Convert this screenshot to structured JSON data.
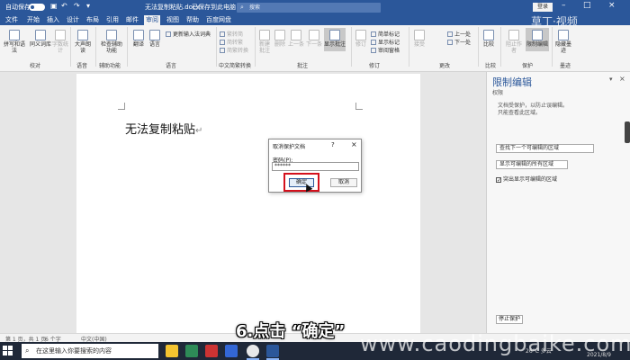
{
  "titlebar": {
    "autosave_label": "自动保存",
    "filename": "无法复制粘贴.docx",
    "saved_state": "已保存到此电脑",
    "search_placeholder": "搜索",
    "login": "登录"
  },
  "tabs": [
    "文件",
    "开始",
    "插入",
    "设计",
    "布局",
    "引用",
    "邮件",
    "审阅",
    "视图",
    "帮助",
    "百度网盘"
  ],
  "active_tab": "审阅",
  "ribbon": {
    "buttons": [
      {
        "label": "拼写和语法"
      },
      {
        "label": "同义词库"
      },
      {
        "label": "字数统计"
      },
      {
        "label": "大声朗读"
      },
      {
        "label": "检查辅助功能"
      },
      {
        "label": "翻译"
      },
      {
        "label": "语言"
      },
      {
        "label": "新建批注"
      },
      {
        "label": "删除"
      },
      {
        "label": "上一条"
      },
      {
        "label": "下一条"
      },
      {
        "label": "显示批注"
      },
      {
        "label": "修订"
      },
      {
        "label": "接受"
      },
      {
        "label": "比较"
      },
      {
        "label": "阻止作者"
      },
      {
        "label": "限制编辑"
      },
      {
        "label": "隐藏墨迹"
      }
    ],
    "smalls": {
      "update": "更新输入法词典",
      "simp": "繁转简",
      "trad": "简转繁",
      "conv": "简繁转换",
      "markup": "简单标记",
      "show_markup": "显示标记",
      "pane": "审阅窗格",
      "prev": "上一处",
      "next": "下一处"
    },
    "groups": [
      "校对",
      "语音",
      "辅助功能",
      "语言",
      "中文简繁转换",
      "批注",
      "修订",
      "更改",
      "比较",
      "保护",
      "墨迹"
    ]
  },
  "document": {
    "text": "无法复制粘贴"
  },
  "dialog": {
    "title": "取消保护文档",
    "help": "?",
    "close": "×",
    "password_label": "密码(P):",
    "password_value": "******",
    "ok": "确定",
    "cancel": "取消"
  },
  "pane": {
    "title": "限制编辑",
    "close": "×",
    "dropdown": "▾",
    "section": "权限",
    "desc1": "文档受保护，以防止误编辑。",
    "desc2": "只能查看此区域。",
    "btn_find": "查找下一个可编辑的区域",
    "btn_show_all": "显示可编辑的所有区域",
    "chk_highlight": "突出显示可编辑的区域",
    "chk_mark": "✓",
    "stop": "停止保护"
  },
  "statusbar": {
    "page": "第 1 页，共 1 页",
    "words": "6 个字",
    "lang": "中文(中国)"
  },
  "taskbar": {
    "search_placeholder": "在这里输入你要搜索的内容",
    "weather": "26°C 多云",
    "date": "2021/8/9"
  },
  "overlay": {
    "caption": "6.点击 “确定”",
    "watermark_url": "www.caodingbaike.com",
    "watermark_logo": "草丁·视频"
  },
  "colors": {
    "accent": "#2b579a",
    "highlight_box": "#d4101c"
  }
}
